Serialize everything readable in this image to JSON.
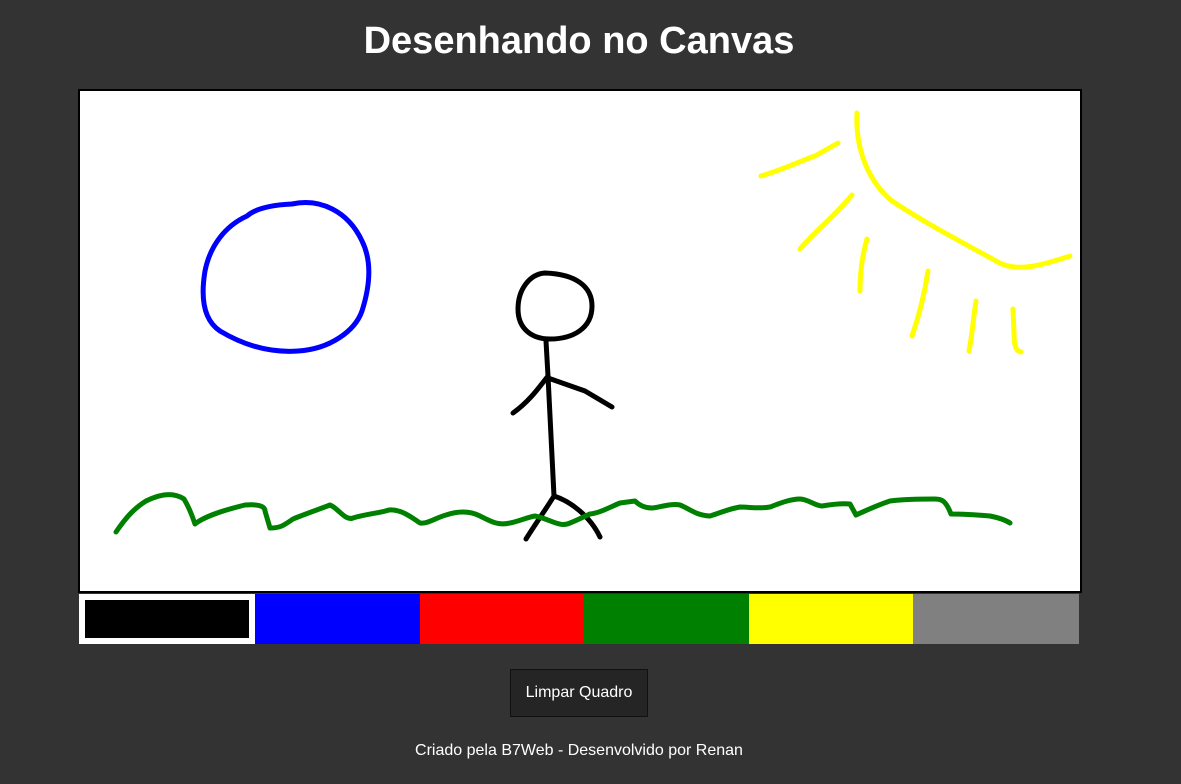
{
  "header": {
    "title": "Desenhando no Canvas"
  },
  "canvas": {
    "background": "#ffffff",
    "strokes": [
      {
        "name": "moon-circle",
        "color": "#0000ff"
      },
      {
        "name": "stick-figure",
        "color": "#000000"
      },
      {
        "name": "sun",
        "color": "#ffff00"
      },
      {
        "name": "grass",
        "color": "#008000"
      }
    ]
  },
  "palette": {
    "colors": [
      {
        "name": "black",
        "hex": "#000000",
        "selected": true
      },
      {
        "name": "blue",
        "hex": "#0000ff",
        "selected": false
      },
      {
        "name": "red",
        "hex": "#ff0000",
        "selected": false
      },
      {
        "name": "green",
        "hex": "#008000",
        "selected": false
      },
      {
        "name": "yellow",
        "hex": "#ffff00",
        "selected": false
      },
      {
        "name": "gray",
        "hex": "#808080",
        "selected": false
      }
    ]
  },
  "actions": {
    "clear_label": "Limpar Quadro"
  },
  "footer": {
    "text": "Criado pela B7Web - Desenvolvido por Renan"
  }
}
